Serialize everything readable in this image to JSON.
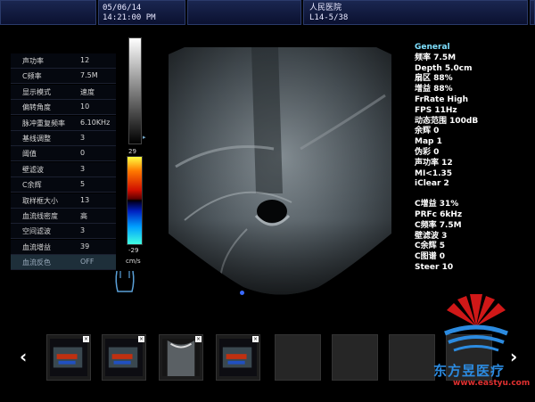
{
  "header": {
    "date": "05/06/14",
    "time": "14:21:00 PM",
    "hospital": "人民医院",
    "probe_code": "L14-5/38"
  },
  "params": [
    {
      "label": "声功率",
      "value": "12"
    },
    {
      "label": "C频率",
      "value": "7.5M"
    },
    {
      "label": "显示模式",
      "value": "速度"
    },
    {
      "label": "偏转角度",
      "value": "10"
    },
    {
      "label": "脉冲重复频率",
      "value": "6.10KHz"
    },
    {
      "label": "基线调整",
      "value": "3"
    },
    {
      "label": "阈值",
      "value": "0"
    },
    {
      "label": "壁滤波",
      "value": "3"
    },
    {
      "label": "C余辉",
      "value": "5"
    },
    {
      "label": "取样框大小",
      "value": "13"
    },
    {
      "label": "血流线密度",
      "value": "高"
    },
    {
      "label": "空间滤波",
      "value": "3"
    },
    {
      "label": "血流增益",
      "value": "39"
    },
    {
      "label": "血流反色",
      "value": "OFF"
    }
  ],
  "colorbar": {
    "top": "29",
    "bottom": "-29",
    "unit": "cm/s"
  },
  "right_panel": {
    "general_title": "General",
    "general": [
      "频率 7.5M",
      "Depth 5.0cm",
      "扇区 88%",
      "增益 88%",
      "FrRate High",
      "FPS 11Hz",
      "动态范围 100dB",
      "余辉 0",
      "Map 1",
      "伪彩 0",
      "声功率 12",
      "MI<1.35",
      "iClear 2"
    ],
    "color": [
      "C增益 31%",
      "PRFc 6kHz",
      "C频率 7.5M",
      "壁滤波 3",
      "C余辉 5",
      "C图谱 0",
      "Steer 10"
    ]
  },
  "nav": {
    "prev": "‹",
    "next": "›"
  },
  "thumb_close": "×",
  "watermark": {
    "brand": "东方昱医疗",
    "url": "www.eastyu.com"
  },
  "colors": {
    "accent": "#7fe0ff",
    "brand_blue": "#2c8be0",
    "brand_red": "#e03030"
  }
}
